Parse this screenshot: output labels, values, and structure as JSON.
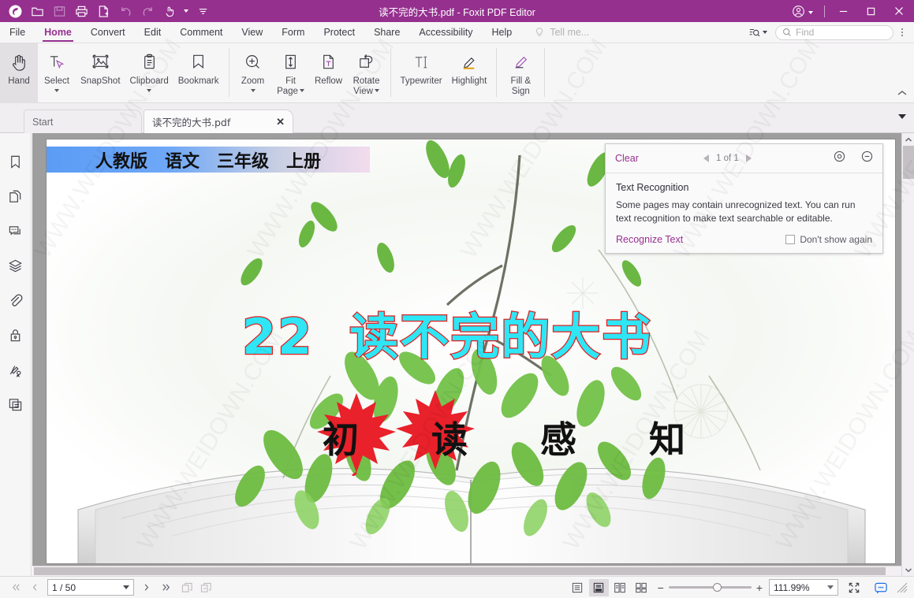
{
  "window": {
    "title": "读不完的大书.pdf - Foxit PDF Editor",
    "quick_access": [
      {
        "name": "foxit-logo-icon",
        "label": "Foxit"
      },
      {
        "name": "open-icon",
        "label": "Open"
      },
      {
        "name": "save-icon",
        "label": "Save"
      },
      {
        "name": "print-icon",
        "label": "Print"
      },
      {
        "name": "create-pdf-icon",
        "label": "Create PDF"
      },
      {
        "name": "undo-icon",
        "label": "Undo"
      },
      {
        "name": "redo-icon",
        "label": "Redo"
      },
      {
        "name": "touch-mode-icon",
        "label": "Touch Mode"
      },
      {
        "name": "customize-toolbar-icon",
        "label": "Customize"
      }
    ],
    "account_label": "Account",
    "minimize_label": "Minimize",
    "maximize_label": "Maximize",
    "close_label": "Close",
    "accent": "#95308f"
  },
  "menubar": {
    "items": [
      {
        "label": "File",
        "active": false
      },
      {
        "label": "Home",
        "active": true
      },
      {
        "label": "Convert",
        "active": false
      },
      {
        "label": "Edit",
        "active": false
      },
      {
        "label": "Comment",
        "active": false
      },
      {
        "label": "View",
        "active": false
      },
      {
        "label": "Form",
        "active": false
      },
      {
        "label": "Protect",
        "active": false
      },
      {
        "label": "Share",
        "active": false
      },
      {
        "label": "Accessibility",
        "active": false
      },
      {
        "label": "Help",
        "active": false
      }
    ],
    "tell_me_placeholder": "Tell me...",
    "find_placeholder": "Find",
    "search_options_label": "Search Options",
    "more_label": "More"
  },
  "ribbon": {
    "groups": [
      {
        "tools": [
          {
            "label": "Hand",
            "label2": "",
            "icon": "hand-icon",
            "selected": true,
            "caret": false
          },
          {
            "label": "Select",
            "label2": "",
            "icon": "select-text-icon",
            "selected": false,
            "caret": true
          },
          {
            "label": "SnapShot",
            "label2": "",
            "icon": "snapshot-icon",
            "selected": false,
            "caret": false
          },
          {
            "label": "Clipboard",
            "label2": "",
            "icon": "clipboard-icon",
            "selected": false,
            "caret": true
          },
          {
            "label": "Bookmark",
            "label2": "",
            "icon": "bookmark-icon",
            "selected": false,
            "caret": false
          }
        ]
      },
      {
        "tools": [
          {
            "label": "Zoom",
            "label2": "",
            "icon": "zoom-in-icon",
            "selected": false,
            "caret": true
          },
          {
            "label": "Fit",
            "label2": "Page",
            "icon": "fit-page-icon",
            "selected": false,
            "caret": true
          },
          {
            "label": "Reflow",
            "label2": "",
            "icon": "reflow-icon",
            "selected": false,
            "caret": false
          },
          {
            "label": "Rotate",
            "label2": "View",
            "icon": "rotate-view-icon",
            "selected": false,
            "caret": true
          }
        ]
      },
      {
        "tools": [
          {
            "label": "Typewriter",
            "label2": "",
            "icon": "typewriter-icon",
            "selected": false,
            "caret": false
          },
          {
            "label": "Highlight",
            "label2": "",
            "icon": "highlight-icon",
            "selected": false,
            "caret": false
          }
        ]
      },
      {
        "tools": [
          {
            "label": "Fill &",
            "label2": "Sign",
            "icon": "fill-sign-icon",
            "selected": false,
            "caret": false
          }
        ]
      }
    ],
    "collapse_label": "Collapse Ribbon"
  },
  "tabs": {
    "start_label": "Start",
    "doc_label": "读不完的大书.pdf",
    "close_label": "✕",
    "list_label": "Tab List"
  },
  "sidebar": {
    "items": [
      {
        "name": "bookmarks-panel",
        "label": "Bookmarks"
      },
      {
        "name": "pages-panel",
        "label": "Page Thumbnails"
      },
      {
        "name": "comments-panel",
        "label": "Comments"
      },
      {
        "name": "layers-panel",
        "label": "Layers"
      },
      {
        "name": "attachments-panel",
        "label": "Attachments"
      },
      {
        "name": "security-panel",
        "label": "Security"
      },
      {
        "name": "signatures-panel",
        "label": "Digital Signatures"
      },
      {
        "name": "stamps-panel",
        "label": "Stamps"
      }
    ],
    "expand_label": "Expand Panel"
  },
  "document": {
    "banner_items": [
      "人教版",
      "语文",
      "三年级",
      "上册"
    ],
    "title_number": "22",
    "title_text": "读不完的大书",
    "subtitle_chars": [
      "初",
      "读",
      "感",
      "知"
    ],
    "title_fill": "#2ee6f5",
    "title_stroke": "#e02020"
  },
  "text_recognition": {
    "clear_label": "Clear",
    "page_counter": "1 of 1",
    "prev_label": "Previous",
    "next_label": "Next",
    "settings_label": "Settings",
    "minimize_label": "Minimize",
    "heading": "Text Recognition",
    "description": "Some pages may contain unrecognized text. You can run text recognition to make text searchable or editable.",
    "action_link": "Recognize Text",
    "dont_show_label": "Don't show again",
    "dont_show_checked": false
  },
  "statusbar": {
    "first_page_label": "First Page",
    "prev_page_label": "Previous Page",
    "page_value": "1 / 50",
    "next_page_label": "Next Page",
    "last_page_label": "Last Page",
    "prev_view_label": "Previous View",
    "next_view_label": "Next View",
    "view_modes": [
      {
        "name": "single-page-view",
        "label": "Single Page",
        "selected": false
      },
      {
        "name": "continuous-view",
        "label": "Continuous",
        "selected": true
      },
      {
        "name": "facing-view",
        "label": "Facing",
        "selected": false
      },
      {
        "name": "facing-continuous-view",
        "label": "Continuous Facing",
        "selected": false
      }
    ],
    "zoom_out_label": "−",
    "zoom_in_label": "+",
    "zoom_value": "111.99%",
    "fullscreen_label": "Full Screen",
    "assistant_label": "Assistant"
  }
}
